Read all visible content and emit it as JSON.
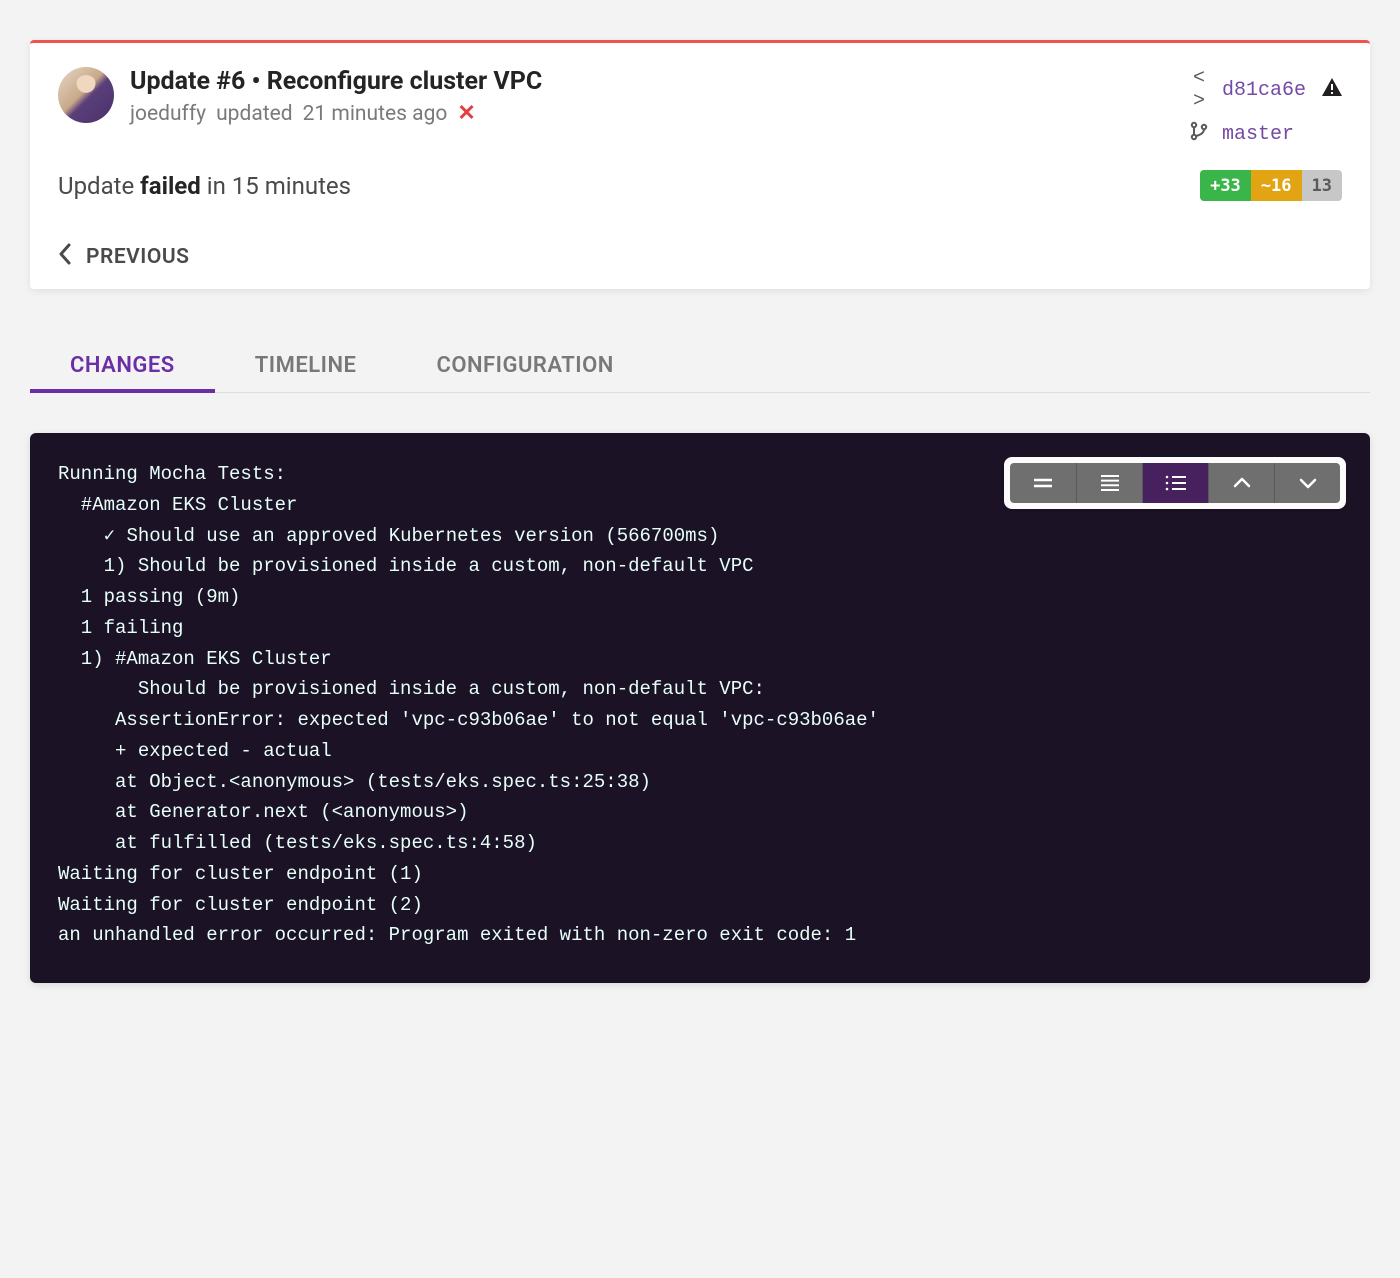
{
  "header": {
    "title": "Update #6 • Reconfigure cluster VPC",
    "user": "joeduffy",
    "action": "updated",
    "time_ago": "21 minutes ago",
    "close_glyph": "✕",
    "commit": "d81ca6e",
    "branch": "master"
  },
  "status": {
    "prefix": "Update",
    "result": "failed",
    "suffix": "in 15 minutes"
  },
  "diff": {
    "added": "+33",
    "modified": "~16",
    "unchanged": "13"
  },
  "nav": {
    "previous": "PREVIOUS"
  },
  "tabs": {
    "changes": "CHANGES",
    "timeline": "TIMELINE",
    "configuration": "CONFIGURATION"
  },
  "icons": {
    "code": "< >",
    "branch": "⎇",
    "warn": "⚠",
    "chev_left": "‹",
    "tb_compact": "=",
    "tb_justify": "≣",
    "tb_list": "≡",
    "tb_up": "˄",
    "tb_down": "˅"
  },
  "console": {
    "text": "Running Mocha Tests:\n  #Amazon EKS Cluster\n    ✓ Should use an approved Kubernetes version (566700ms)\n    1) Should be provisioned inside a custom, non-default VPC\n  1 passing (9m)\n  1 failing\n  1) #Amazon EKS Cluster\n       Should be provisioned inside a custom, non-default VPC:\n     AssertionError: expected 'vpc-c93b06ae' to not equal 'vpc-c93b06ae'\n     + expected - actual\n     at Object.<anonymous> (tests/eks.spec.ts:25:38)\n     at Generator.next (<anonymous>)\n     at fulfilled (tests/eks.spec.ts:4:58)\nWaiting for cluster endpoint (1)\nWaiting for cluster endpoint (2)\nan unhandled error occurred: Program exited with non-zero exit code: 1"
  }
}
